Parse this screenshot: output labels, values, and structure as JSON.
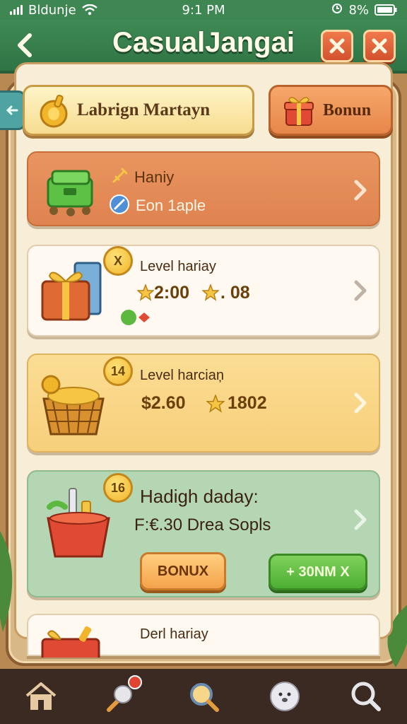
{
  "status_bar": {
    "carrier": "Bldunje",
    "time": "9:1 PM",
    "battery": "8%"
  },
  "header": {
    "title": "CasualJangai"
  },
  "tabs": {
    "main_label": "Labrign Martayn",
    "bonus_label": "Bonun"
  },
  "cards": [
    {
      "line1": "Haniy",
      "line2": "Eon 1aple"
    },
    {
      "badge": "X",
      "title": "Level hariay",
      "value_a": "2:00",
      "value_b": ". 08"
    },
    {
      "badge": "14",
      "title": "Level harciaņ",
      "value_a": "$2.60",
      "value_b": "1802"
    },
    {
      "badge": "16",
      "title": "Hadigh daday:",
      "subtitle": "F:€.30 Drea Sopls",
      "button_bonus": "BONUX",
      "button_green": "+ 30NM X"
    },
    {
      "title": "Derl hariay"
    }
  ],
  "colors": {
    "header_green": "#3f8a55",
    "accent_orange": "#e6864a",
    "accent_gold": "#f0b52a",
    "nav_bg": "#3b2a22"
  },
  "nav": {
    "icons": [
      "home-icon",
      "map-pin-icon",
      "search-icon",
      "avatar-icon",
      "magnifier-icon"
    ],
    "notification": true
  }
}
